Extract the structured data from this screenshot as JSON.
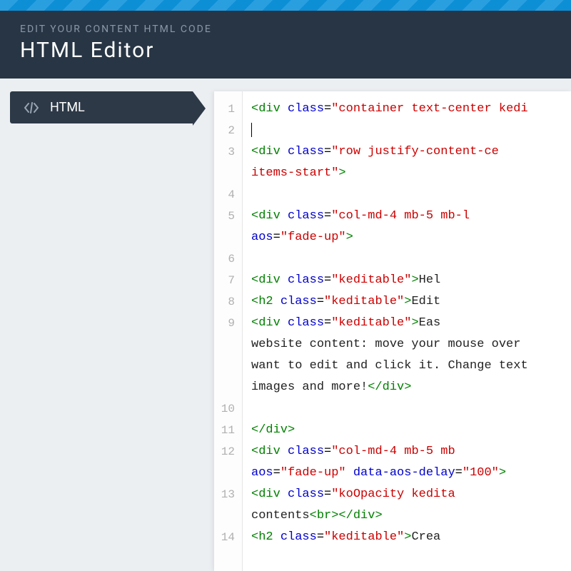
{
  "header": {
    "subtitle": "EDIT YOUR CONTENT HTML CODE",
    "title": "HTML Editor"
  },
  "sidebar": {
    "tab_label": "HTML",
    "tab_icon": "code-icon"
  },
  "editor": {
    "lines": [
      {
        "num": "1",
        "tokens": [
          [
            "tag",
            "<div"
          ],
          [
            "punc",
            " "
          ],
          [
            "attr",
            "class"
          ],
          [
            "punc",
            "="
          ],
          [
            "val",
            "\"container text-center kedi"
          ]
        ]
      },
      {
        "num": "2",
        "tokens": [
          [
            "text",
            "    "
          ],
          [
            "caret",
            ""
          ]
        ]
      },
      {
        "num": "3",
        "wrap": true,
        "tokens": [
          [
            "text",
            "    "
          ],
          [
            "tag",
            "<div"
          ],
          [
            "punc",
            " "
          ],
          [
            "attr",
            "class"
          ],
          [
            "punc",
            "="
          ],
          [
            "val",
            "\"row justify-content-ce"
          ],
          [
            "break",
            ""
          ],
          [
            "val",
            "items-start\""
          ],
          [
            "tag",
            ">"
          ]
        ]
      },
      {
        "num": "4",
        "tokens": [
          [
            "text",
            " "
          ]
        ]
      },
      {
        "num": "5",
        "wrap": true,
        "tokens": [
          [
            "text",
            "        "
          ],
          [
            "tag",
            "<div"
          ],
          [
            "punc",
            " "
          ],
          [
            "attr",
            "class"
          ],
          [
            "punc",
            "="
          ],
          [
            "val",
            "\"col-md-4 mb-5 mb-l"
          ],
          [
            "break",
            ""
          ],
          [
            "attr",
            "aos"
          ],
          [
            "punc",
            "="
          ],
          [
            "val",
            "\"fade-up\""
          ],
          [
            "tag",
            ">"
          ]
        ]
      },
      {
        "num": "6",
        "tokens": [
          [
            "text",
            " "
          ]
        ]
      },
      {
        "num": "7",
        "tokens": [
          [
            "text",
            "            "
          ],
          [
            "tag",
            "<div"
          ],
          [
            "punc",
            " "
          ],
          [
            "attr",
            "class"
          ],
          [
            "punc",
            "="
          ],
          [
            "val",
            "\"keditable\""
          ],
          [
            "tag",
            ">"
          ],
          [
            "text",
            "Hel"
          ]
        ]
      },
      {
        "num": "8",
        "tokens": [
          [
            "text",
            "            "
          ],
          [
            "tag",
            "<h2"
          ],
          [
            "punc",
            " "
          ],
          [
            "attr",
            "class"
          ],
          [
            "punc",
            "="
          ],
          [
            "val",
            "\"keditable\""
          ],
          [
            "tag",
            ">"
          ],
          [
            "text",
            "Edit"
          ]
        ]
      },
      {
        "num": "9",
        "wrap": true,
        "tokens": [
          [
            "text",
            "            "
          ],
          [
            "tag",
            "<div"
          ],
          [
            "punc",
            " "
          ],
          [
            "attr",
            "class"
          ],
          [
            "punc",
            "="
          ],
          [
            "val",
            "\"keditable\""
          ],
          [
            "tag",
            ">"
          ],
          [
            "text",
            "Eas"
          ],
          [
            "break",
            ""
          ],
          [
            "text",
            "website content: move your mouse over "
          ],
          [
            "break",
            ""
          ],
          [
            "text",
            "want to edit and click it. Change text"
          ],
          [
            "break",
            ""
          ],
          [
            "text",
            "images and more!"
          ],
          [
            "tag",
            "</div>"
          ]
        ]
      },
      {
        "num": "10",
        "tokens": [
          [
            "text",
            " "
          ]
        ]
      },
      {
        "num": "11",
        "tokens": [
          [
            "text",
            "        "
          ],
          [
            "tag",
            "</div>"
          ]
        ]
      },
      {
        "num": "12",
        "wrap": true,
        "tokens": [
          [
            "text",
            "        "
          ],
          [
            "tag",
            "<div"
          ],
          [
            "punc",
            " "
          ],
          [
            "attr",
            "class"
          ],
          [
            "punc",
            "="
          ],
          [
            "val",
            "\"col-md-4 mb-5 mb"
          ],
          [
            "break",
            ""
          ],
          [
            "attr",
            "aos"
          ],
          [
            "punc",
            "="
          ],
          [
            "val",
            "\"fade-up\""
          ],
          [
            "punc",
            " "
          ],
          [
            "attr",
            "data-aos-delay"
          ],
          [
            "punc",
            "="
          ],
          [
            "val",
            "\"100\""
          ],
          [
            "tag",
            ">"
          ]
        ]
      },
      {
        "num": "13",
        "wrap": true,
        "tokens": [
          [
            "text",
            "            "
          ],
          [
            "tag",
            "<div"
          ],
          [
            "punc",
            " "
          ],
          [
            "attr",
            "class"
          ],
          [
            "punc",
            "="
          ],
          [
            "val",
            "\"koOpacity kedita"
          ],
          [
            "break",
            ""
          ],
          [
            "text",
            "contents"
          ],
          [
            "tag",
            "<br></div>"
          ]
        ]
      },
      {
        "num": "14",
        "tokens": [
          [
            "text",
            "            "
          ],
          [
            "tag",
            "<h2"
          ],
          [
            "punc",
            " "
          ],
          [
            "attr",
            "class"
          ],
          [
            "punc",
            "="
          ],
          [
            "val",
            "\"keditable\""
          ],
          [
            "tag",
            ">"
          ],
          [
            "text",
            "Crea"
          ]
        ]
      }
    ]
  }
}
